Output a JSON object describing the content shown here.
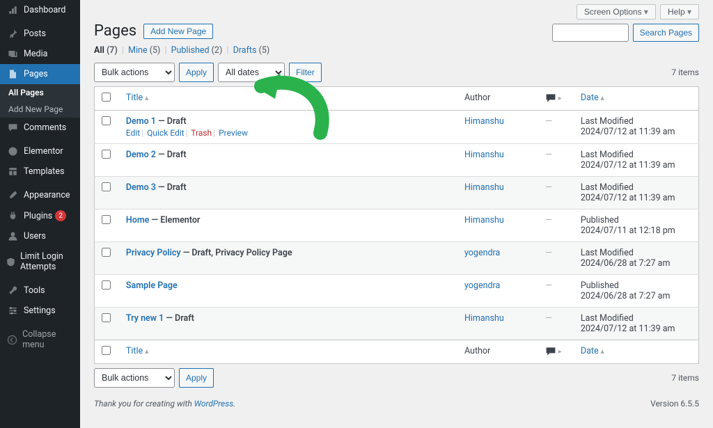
{
  "sidebar": {
    "items": [
      {
        "label": "Dashboard",
        "icon": "dashboard"
      },
      {
        "label": "Posts",
        "icon": "pin"
      },
      {
        "label": "Media",
        "icon": "media"
      },
      {
        "label": "Pages",
        "icon": "pages",
        "current": true
      },
      {
        "label": "Comments",
        "icon": "comment"
      },
      {
        "label": "Elementor",
        "icon": "elementor"
      },
      {
        "label": "Templates",
        "icon": "templates"
      },
      {
        "label": "Appearance",
        "icon": "brush"
      },
      {
        "label": "Plugins",
        "icon": "plug",
        "badge": "2"
      },
      {
        "label": "Users",
        "icon": "user"
      },
      {
        "label": "Limit Login Attempts",
        "icon": "shield"
      },
      {
        "label": "Tools",
        "icon": "wrench"
      },
      {
        "label": "Settings",
        "icon": "sliders"
      },
      {
        "label": "Collapse menu",
        "icon": "collapse"
      }
    ],
    "sub": [
      {
        "label": "All Pages",
        "current": true
      },
      {
        "label": "Add New Page"
      }
    ]
  },
  "top": {
    "screen_options": "Screen Options",
    "help": "Help"
  },
  "header": {
    "title": "Pages",
    "add_new": "Add New Page"
  },
  "subsub": {
    "all": "All",
    "all_count": "(7)",
    "mine": "Mine",
    "mine_count": "(5)",
    "published": "Published",
    "published_count": "(2)",
    "drafts": "Drafts",
    "drafts_count": "(5)"
  },
  "search": {
    "placeholder": "",
    "button": "Search Pages"
  },
  "filters": {
    "bulk_label": "Bulk actions",
    "apply": "Apply",
    "dates_label": "All dates",
    "filter": "Filter",
    "items_count": "7 items"
  },
  "columns": {
    "title": "Title",
    "author": "Author",
    "date": "Date"
  },
  "row_actions": {
    "edit": "Edit",
    "quick_edit": "Quick Edit",
    "trash": "Trash",
    "preview": "Preview"
  },
  "rows": [
    {
      "title": "Demo 1",
      "state": "— Draft",
      "author": "Himanshu",
      "date_label": "Last Modified",
      "date_val": "2024/07/12 at 11:39 am",
      "actions": true
    },
    {
      "title": "Demo 2",
      "state": "— Draft",
      "author": "Himanshu",
      "date_label": "Last Modified",
      "date_val": "2024/07/12 at 11:39 am"
    },
    {
      "title": "Demo 3",
      "state": "— Draft",
      "author": "Himanshu",
      "date_label": "Last Modified",
      "date_val": "2024/07/12 at 11:39 am"
    },
    {
      "title": "Home",
      "state": "— Elementor",
      "author": "Himanshu",
      "date_label": "Published",
      "date_val": "2024/07/11 at 12:18 pm"
    },
    {
      "title": "Privacy Policy",
      "state": "— Draft, Privacy Policy Page",
      "author": "yogendra",
      "date_label": "Last Modified",
      "date_val": "2024/06/28 at 7:27 am"
    },
    {
      "title": "Sample Page",
      "state": "",
      "author": "yogendra",
      "date_label": "Published",
      "date_val": "2024/06/28 at 7:27 am"
    },
    {
      "title": "Try new 1",
      "state": "— Draft",
      "author": "Himanshu",
      "date_label": "Last Modified",
      "date_val": "2024/07/12 at 11:39 am"
    }
  ],
  "footer": {
    "thank": "Thank you for creating with ",
    "wp": "WordPress",
    "version": "Version 6.5.5"
  }
}
